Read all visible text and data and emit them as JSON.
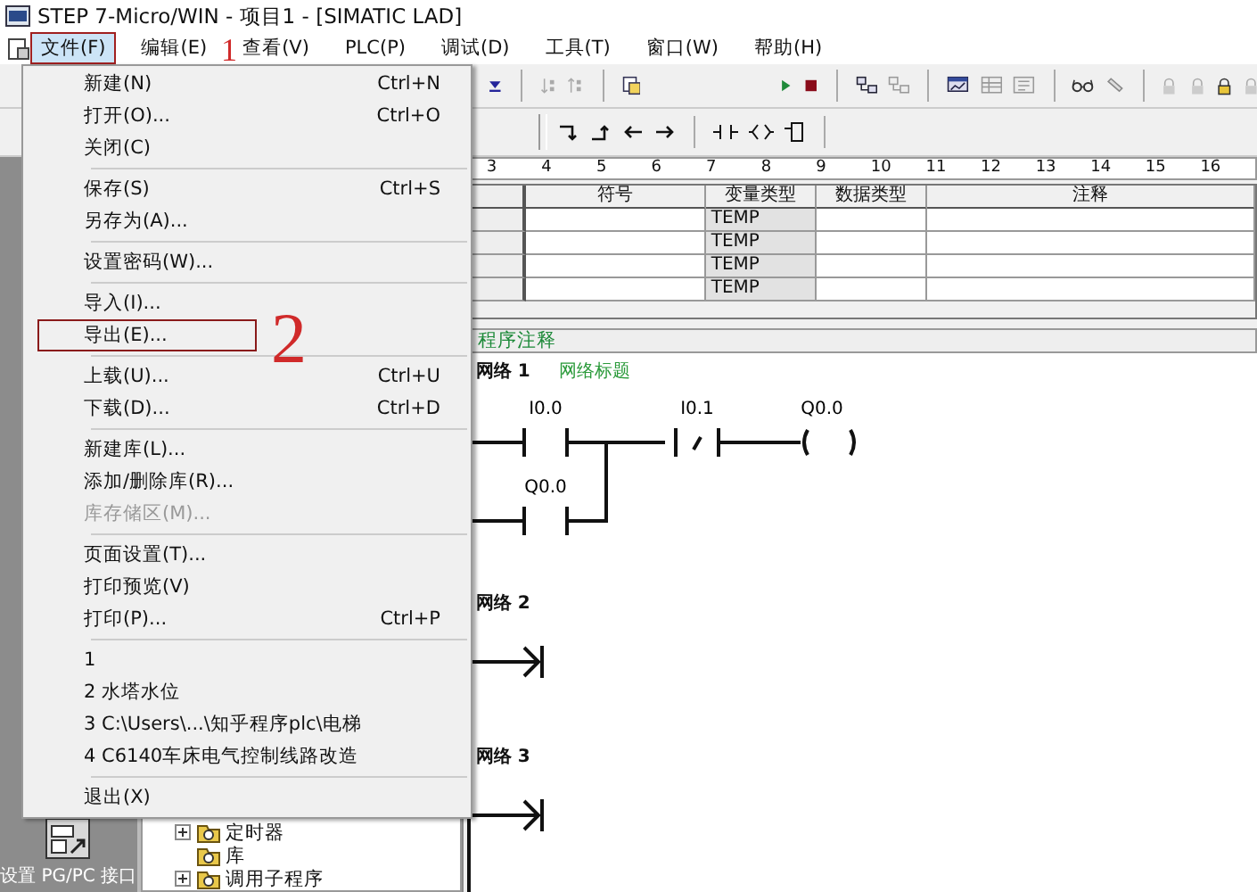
{
  "window": {
    "title": "STEP 7-Micro/WIN - 项目1 - [SIMATIC LAD]"
  },
  "menubar": [
    {
      "label": "文件(F)",
      "selected": true,
      "marked": true
    },
    {
      "label": "编辑(E)",
      "selected": false,
      "marked": false
    },
    {
      "label": "查看(V)",
      "selected": false,
      "marked": false
    },
    {
      "label": "PLC(P)",
      "selected": false,
      "marked": false
    },
    {
      "label": "调试(D)",
      "selected": false,
      "marked": false
    },
    {
      "label": "工具(T)",
      "selected": false,
      "marked": false
    },
    {
      "label": "窗口(W)",
      "selected": false,
      "marked": false
    },
    {
      "label": "帮助(H)",
      "selected": false,
      "marked": false
    }
  ],
  "file_menu": {
    "groups": [
      [
        {
          "label": "新建(N)",
          "shortcut": "Ctrl+N",
          "disabled": false,
          "marked": false
        },
        {
          "label": "打开(O)...",
          "shortcut": "Ctrl+O",
          "disabled": false,
          "marked": false
        },
        {
          "label": "关闭(C)",
          "disabled": false,
          "marked": false
        }
      ],
      [
        {
          "label": "保存(S)",
          "shortcut": "Ctrl+S",
          "disabled": false,
          "marked": false
        },
        {
          "label": "另存为(A)...",
          "disabled": false,
          "marked": false
        }
      ],
      [
        {
          "label": "设置密码(W)...",
          "disabled": false,
          "marked": false
        }
      ],
      [
        {
          "label": "导入(I)...",
          "disabled": false,
          "marked": false
        },
        {
          "label": "导出(E)...",
          "disabled": false,
          "marked": true
        }
      ],
      [
        {
          "label": "上载(U)...",
          "shortcut": "Ctrl+U",
          "disabled": false,
          "marked": false
        },
        {
          "label": "下载(D)...",
          "shortcut": "Ctrl+D",
          "disabled": false,
          "marked": false
        }
      ],
      [
        {
          "label": "新建库(L)...",
          "disabled": false,
          "marked": false
        },
        {
          "label": "添加/删除库(R)...",
          "disabled": false,
          "marked": false
        },
        {
          "label": "库存储区(M)...",
          "disabled": true,
          "marked": false
        }
      ],
      [
        {
          "label": "页面设置(T)...",
          "disabled": false,
          "marked": false
        },
        {
          "label": "打印预览(V)",
          "disabled": false,
          "marked": false
        },
        {
          "label": "打印(P)...",
          "shortcut": "Ctrl+P",
          "disabled": false,
          "marked": false
        }
      ],
      [
        {
          "label": "1",
          "disabled": false,
          "marked": false
        },
        {
          "label": "2 水塔水位",
          "disabled": false,
          "marked": false
        },
        {
          "label": "3 C:\\Users\\...\\知乎程序plc\\电梯",
          "disabled": false,
          "marked": false
        },
        {
          "label": "4 C6140车床电气控制线路改造",
          "disabled": false,
          "marked": false
        }
      ],
      [
        {
          "label": "退出(X)",
          "disabled": false,
          "marked": false
        }
      ]
    ]
  },
  "annotations": [
    "1",
    "2"
  ],
  "navigation_bar": {
    "label": "设置 PG/PC 接口"
  },
  "tree": [
    {
      "label": "定时器",
      "expandable": true
    },
    {
      "label": "库",
      "expandable": false
    },
    {
      "label": "调用子程序",
      "expandable": true
    }
  ],
  "ruler": [
    "3",
    "4",
    "5",
    "6",
    "7",
    "8",
    "9",
    "10",
    "11",
    "12",
    "13",
    "14",
    "15",
    "16"
  ],
  "variable_table": {
    "columns": [
      "符号",
      "变量类型",
      "数据类型",
      "注释"
    ],
    "rows": [
      [
        "",
        "TEMP",
        "",
        ""
      ],
      [
        "",
        "TEMP",
        "",
        ""
      ],
      [
        "",
        "TEMP",
        "",
        ""
      ],
      [
        "",
        "TEMP",
        "",
        ""
      ]
    ]
  },
  "program_comment": "程序注释",
  "networks": [
    {
      "title": "网络 1",
      "comment": "网络标题",
      "elements": [
        {
          "kind": "contact",
          "address": "I0.0"
        },
        {
          "kind": "contact_nc",
          "address": "I0.1"
        },
        {
          "kind": "coil",
          "address": "Q0.0"
        }
      ],
      "branch": [
        {
          "kind": "contact",
          "address": "Q0.0"
        }
      ]
    },
    {
      "title": "网络 2"
    },
    {
      "title": "网络 3"
    }
  ]
}
